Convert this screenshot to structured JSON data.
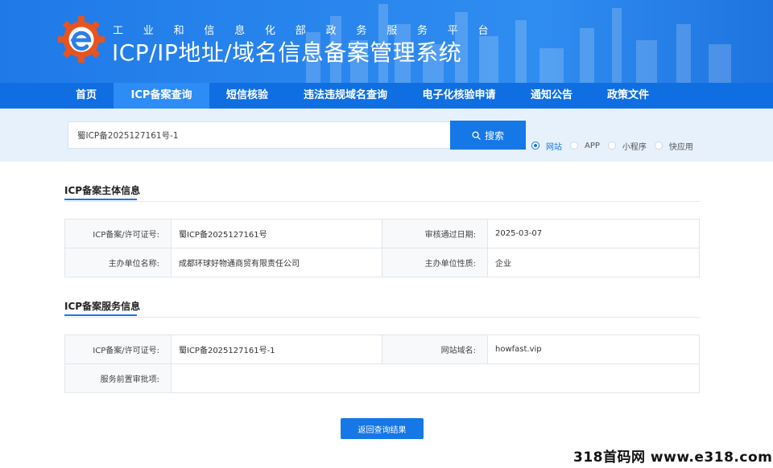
{
  "header": {
    "subtitle": "工业和信息化部政务服务平台",
    "title": "ICP/IP地址/域名信息备案管理系统"
  },
  "nav": {
    "items": [
      {
        "label": "首页",
        "active": false
      },
      {
        "label": "ICP备案查询",
        "active": true
      },
      {
        "label": "短信核验",
        "active": false
      },
      {
        "label": "违法违规域名查询",
        "active": false
      },
      {
        "label": "电子化核验申请",
        "active": false
      },
      {
        "label": "通知公告",
        "active": false
      },
      {
        "label": "政策文件",
        "active": false
      }
    ]
  },
  "search": {
    "value": "蜀ICP备2025127161号-1",
    "button_label": "搜索",
    "types": [
      {
        "label": "网站",
        "checked": true
      },
      {
        "label": "APP",
        "checked": false
      },
      {
        "label": "小程序",
        "checked": false
      },
      {
        "label": "快应用",
        "checked": false
      }
    ]
  },
  "subject_info": {
    "title": "ICP备案主体信息",
    "rows": [
      {
        "k1": "ICP备案/许可证号:",
        "v1": "蜀ICP备2025127161号",
        "k2": "审核通过日期:",
        "v2": "2025-03-07"
      },
      {
        "k1": "主办单位名称:",
        "v1": "成都环球好物通商贸有限责任公司",
        "k2": "主办单位性质:",
        "v2": "企业"
      }
    ]
  },
  "service_info": {
    "title": "ICP备案服务信息",
    "row1": {
      "k1": "ICP备案/许可证号:",
      "v1": "蜀ICP备2025127161号-1",
      "k2": "网站域名:",
      "v2": "howfast.vip"
    },
    "row2": {
      "k1": "服务前置审批项:",
      "v1": ""
    }
  },
  "back_button_label": "返回查询结果",
  "watermark": "318首码网 www.e318.com",
  "colors": {
    "primary": "#1677e6",
    "nav": "#0f6fe2",
    "nav_active": "#2d8cf5",
    "search_bg": "#e7f1fb"
  }
}
